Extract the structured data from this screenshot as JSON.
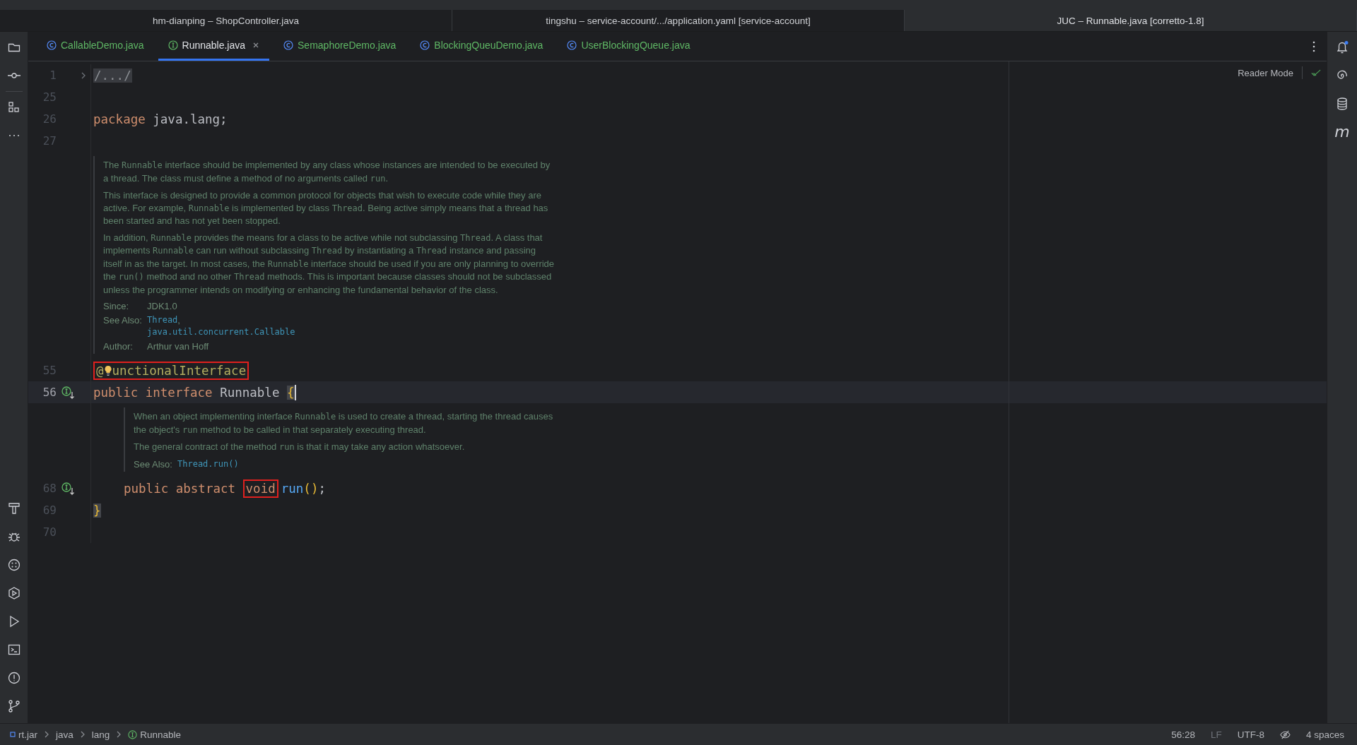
{
  "project_tabs": [
    {
      "label": "hm-dianping – ShopController.java",
      "selected": false
    },
    {
      "label": "tingshu – service-account/.../application.yaml [service-account]",
      "selected": false
    },
    {
      "label": "JUC – Runnable.java [corretto-1.8]",
      "selected": true
    }
  ],
  "editor_tabs": [
    {
      "label": "CallableDemo.java",
      "kind": "class",
      "selected": false
    },
    {
      "label": "Runnable.java",
      "kind": "interface",
      "selected": true
    },
    {
      "label": "SemaphoreDemo.java",
      "kind": "class",
      "selected": false
    },
    {
      "label": "BlockingQueuDemo.java",
      "kind": "class",
      "selected": false
    },
    {
      "label": "UserBlockingQueue.java",
      "kind": "class",
      "selected": false
    }
  ],
  "reader_mode": {
    "label": "Reader Mode"
  },
  "lines": [
    {
      "kind": "code",
      "number": "1",
      "fold": true,
      "tokens": [
        {
          "text": "/.../",
          "kind": "folded"
        }
      ]
    },
    {
      "kind": "code",
      "number": "25"
    },
    {
      "kind": "code",
      "number": "26",
      "tokens": [
        {
          "text": "package",
          "kind": "keyword"
        },
        {
          "text": " java.lang;",
          "kind": "plain"
        }
      ]
    },
    {
      "kind": "code",
      "number": "27"
    },
    {
      "kind": "doc",
      "indented": false,
      "paragraphs": [
        [
          {
            "t": "The "
          },
          {
            "t": "Runnable",
            "mono": true
          },
          {
            "t": " interface should be implemented by any class whose instances are intended to be executed by a thread. The class must define a method of no arguments called "
          },
          {
            "t": "run",
            "mono": true
          },
          {
            "t": "."
          }
        ],
        [
          {
            "t": "This interface is designed to provide a common protocol for objects that wish to execute code while they are active. For example, "
          },
          {
            "t": "Runnable",
            "mono": true
          },
          {
            "t": " is implemented by class "
          },
          {
            "t": "Thread",
            "mono": true
          },
          {
            "t": ". Being active simply means that a thread has been started and has not yet been stopped."
          }
        ],
        [
          {
            "t": "In addition, "
          },
          {
            "t": "Runnable",
            "mono": true
          },
          {
            "t": " provides the means for a class to be active while not subclassing "
          },
          {
            "t": "Thread",
            "mono": true
          },
          {
            "t": ". A class that implements "
          },
          {
            "t": "Runnable",
            "mono": true
          },
          {
            "t": " can run without subclassing "
          },
          {
            "t": "Thread",
            "mono": true
          },
          {
            "t": " by instantiating a "
          },
          {
            "t": "Thread",
            "mono": true
          },
          {
            "t": " instance and passing itself in as the target. In most cases, the "
          },
          {
            "t": "Runnable",
            "mono": true
          },
          {
            "t": " interface should be used if you are only planning to override the "
          },
          {
            "t": "run()",
            "mono": true
          },
          {
            "t": " method and no other "
          },
          {
            "t": "Thread",
            "mono": true
          },
          {
            "t": " methods. This is important because classes should not be subclassed unless the programmer intends on modifying or enhancing the fundamental behavior of the class."
          }
        ]
      ],
      "tags": [
        {
          "label": "Since:",
          "values": [
            [
              {
                "t": "JDK1.0"
              }
            ]
          ]
        },
        {
          "label": "See Also:",
          "values": [
            [
              {
                "t": "Thread",
                "link": true
              },
              {
                "t": ","
              }
            ],
            [
              {
                "t": "java.util.concurrent.Callable",
                "link": true
              }
            ]
          ]
        },
        {
          "label": "Author:",
          "values": [
            [
              {
                "t": "Arthur van Hoff"
              }
            ]
          ]
        }
      ]
    },
    {
      "kind": "code",
      "number": "55",
      "tokens": [
        {
          "text": "@",
          "kind": "annotation",
          "boxed": true
        },
        {
          "kind": "bulb",
          "boxed": true
        },
        {
          "text": "unctionalInterface",
          "kind": "annotation",
          "boxed": true
        }
      ]
    },
    {
      "kind": "code",
      "number": "56",
      "current": true,
      "implemented": true,
      "tokens": [
        {
          "text": "public ",
          "kind": "keyword"
        },
        {
          "text": "interface",
          "kind": "keyword"
        },
        {
          "text": " Runnable ",
          "kind": "plain"
        },
        {
          "text": "{",
          "kind": "brace",
          "matched": true,
          "caret_after": true
        }
      ]
    },
    {
      "kind": "doc",
      "indented": true,
      "paragraphs": [
        [
          {
            "t": "When an object implementing interface "
          },
          {
            "t": "Runnable",
            "mono": true
          },
          {
            "t": " is used to create a thread, starting the thread causes the object's "
          },
          {
            "t": "run",
            "mono": true
          },
          {
            "t": " method to be called in that separately executing thread."
          }
        ],
        [
          {
            "t": "The general contract of the method "
          },
          {
            "t": "run",
            "mono": true
          },
          {
            "t": " is that it may take any action whatsoever."
          }
        ]
      ],
      "tags": [
        {
          "label": "See Also:",
          "values": [
            [
              {
                "t": "Thread.run()",
                "link": true
              }
            ]
          ]
        }
      ]
    },
    {
      "kind": "code",
      "number": "68",
      "indented": true,
      "implemented": true,
      "tokens": [
        {
          "text": "public abstract ",
          "kind": "keyword"
        },
        {
          "text": "void",
          "kind": "keyword",
          "boxed": true
        },
        {
          "text": "run",
          "kind": "method"
        },
        {
          "text": "()",
          "kind": "paren"
        },
        {
          "text": ";",
          "kind": "plain"
        }
      ]
    },
    {
      "kind": "code",
      "number": "69",
      "tokens": [
        {
          "text": "}",
          "kind": "brace",
          "matched": true
        }
      ]
    },
    {
      "kind": "code",
      "number": "70"
    }
  ],
  "right_toolbar": {
    "maven_glyph": "m"
  },
  "status_bar": {
    "breadcrumbs": [
      {
        "label": "rt.jar",
        "kind": "jar"
      },
      {
        "label": "java",
        "kind": "package"
      },
      {
        "label": "lang",
        "kind": "package"
      },
      {
        "label": "Runnable",
        "kind": "interface"
      }
    ],
    "position": "56:28",
    "line_separator": "LF",
    "encoding": "UTF-8",
    "indent": "4 spaces"
  }
}
